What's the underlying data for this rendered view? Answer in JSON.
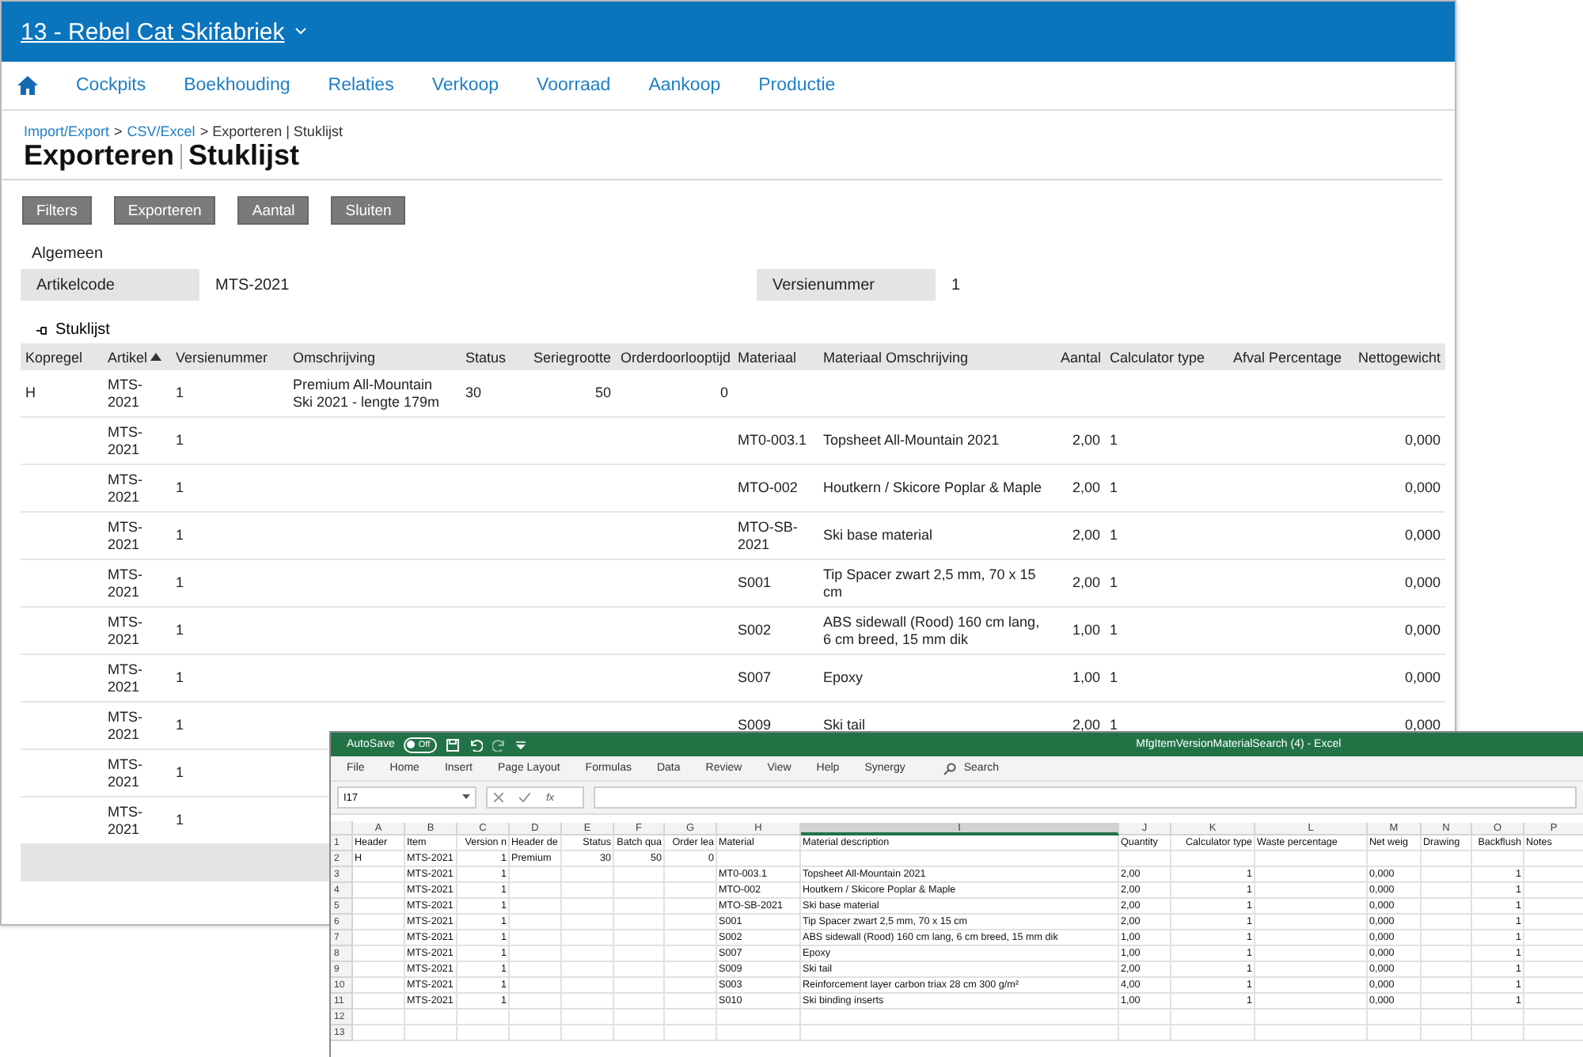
{
  "web": {
    "company": "13 - Rebel Cat Skifabriek",
    "nav": [
      "Cockpits",
      "Boekhouding",
      "Relaties",
      "Verkoop",
      "Voorraad",
      "Aankoop",
      "Productie"
    ],
    "breadcrumb": [
      {
        "label": "Import/Export",
        "link": true
      },
      {
        "label": ">",
        "link": false
      },
      {
        "label": "CSV/Excel",
        "link": true
      },
      {
        "label": "> Exporteren | Stuklijst",
        "link": false
      }
    ],
    "title": [
      "Exporteren",
      "Stuklijst"
    ],
    "buttons": [
      "Filters",
      "Exporteren",
      "Aantal",
      "Sluiten"
    ],
    "general": {
      "title": "Algemeen",
      "fields": [
        {
          "label": "Artikelcode",
          "value": "MTS-2021"
        },
        {
          "label": "Versienummer",
          "value": "1"
        }
      ]
    },
    "bom": {
      "title": "Stuklijst",
      "columns": [
        {
          "label": "Kopregel",
          "numeric": false,
          "sorted": false
        },
        {
          "label": "Artikel",
          "numeric": false,
          "sorted": true
        },
        {
          "label": "Versienummer",
          "numeric": false,
          "sorted": false
        },
        {
          "label": "Omschrijving",
          "numeric": false,
          "sorted": false
        },
        {
          "label": "Status",
          "numeric": false,
          "sorted": false
        },
        {
          "label": "Seriegrootte",
          "numeric": true,
          "sorted": false
        },
        {
          "label": "Orderdoorlooptijd",
          "numeric": true,
          "sorted": false
        },
        {
          "label": "Materiaal",
          "numeric": false,
          "sorted": false
        },
        {
          "label": "Materiaal Omschrijving",
          "numeric": false,
          "sorted": false
        },
        {
          "label": "Aantal",
          "numeric": true,
          "sorted": false
        },
        {
          "label": "Calculator type",
          "numeric": false,
          "sorted": false
        },
        {
          "label": "Afval Percentage",
          "numeric": false,
          "sorted": false
        },
        {
          "label": "Nettogewicht",
          "numeric": true,
          "sorted": false
        }
      ],
      "rows": [
        [
          "H",
          "MTS-2021",
          "1",
          "Premium All-Mountain Ski 2021 - lengte 179m",
          "30",
          "50",
          "0",
          null,
          null,
          null,
          null,
          null,
          null
        ],
        [
          null,
          "MTS-2021",
          "1",
          null,
          null,
          null,
          null,
          "MT0-003.1",
          "Topsheet All-Mountain 2021",
          "2,00",
          "1",
          null,
          "0,000"
        ],
        [
          null,
          "MTS-2021",
          "1",
          null,
          null,
          null,
          null,
          "MTO-002",
          "Houtkern / Skicore Poplar & Maple",
          "2,00",
          "1",
          null,
          "0,000"
        ],
        [
          null,
          "MTS-2021",
          "1",
          null,
          null,
          null,
          null,
          "MTO-SB-2021",
          "Ski base material",
          "2,00",
          "1",
          null,
          "0,000"
        ],
        [
          null,
          "MTS-2021",
          "1",
          null,
          null,
          null,
          null,
          "S001",
          "Tip Spacer zwart 2,5 mm, 70 x 15 cm",
          "2,00",
          "1",
          null,
          "0,000"
        ],
        [
          null,
          "MTS-2021",
          "1",
          null,
          null,
          null,
          null,
          "S002",
          "ABS sidewall (Rood) 160 cm lang, 6 cm breed, 15 mm dik",
          "1,00",
          "1",
          null,
          "0,000"
        ],
        [
          null,
          "MTS-2021",
          "1",
          null,
          null,
          null,
          null,
          "S007",
          "Epoxy",
          "1,00",
          "1",
          null,
          "0,000"
        ],
        [
          null,
          "MTS-2021",
          "1",
          null,
          null,
          null,
          null,
          "S009",
          "Ski tail",
          "2,00",
          "1",
          null,
          "0,000"
        ],
        [
          null,
          "MTS-2021",
          "1",
          null,
          null,
          null,
          null,
          null,
          null,
          null,
          null,
          null,
          null
        ],
        [
          null,
          "MTS-2021",
          "1",
          null,
          null,
          null,
          null,
          null,
          null,
          null,
          null,
          null,
          null
        ]
      ]
    }
  },
  "excel": {
    "autosave": {
      "label": "AutoSave",
      "on": false,
      "state": "Off"
    },
    "title": "MfgItemVersionMaterialSearch (4)  -  Excel",
    "menu": [
      "File",
      "Home",
      "Insert",
      "Page Layout",
      "Formulas",
      "Data",
      "Review",
      "View",
      "Help",
      "Synergy"
    ],
    "search": "Search",
    "name_box": "I17",
    "fx": "fx",
    "columns": [
      {
        "letter": "A",
        "numeric": false,
        "selected": false
      },
      {
        "letter": "B",
        "numeric": false,
        "selected": false
      },
      {
        "letter": "C",
        "numeric": true,
        "selected": false
      },
      {
        "letter": "D",
        "numeric": false,
        "selected": false
      },
      {
        "letter": "E",
        "numeric": true,
        "selected": false
      },
      {
        "letter": "F",
        "numeric": true,
        "selected": false
      },
      {
        "letter": "G",
        "numeric": true,
        "selected": false
      },
      {
        "letter": "H",
        "numeric": false,
        "selected": false
      },
      {
        "letter": "I",
        "numeric": false,
        "selected": true
      },
      {
        "letter": "J",
        "numeric": false,
        "selected": false
      },
      {
        "letter": "K",
        "numeric": true,
        "selected": false
      },
      {
        "letter": "L",
        "numeric": false,
        "selected": false
      },
      {
        "letter": "M",
        "numeric": false,
        "selected": false
      },
      {
        "letter": "N",
        "numeric": false,
        "selected": false
      },
      {
        "letter": "O",
        "numeric": true,
        "selected": false
      },
      {
        "letter": "P",
        "numeric": false,
        "selected": false
      }
    ],
    "rows": [
      {
        "n": "1",
        "cells": [
          "Header",
          "Item",
          "Version n",
          "Header de",
          "Status",
          "Batch qua",
          "Order lea",
          "Material",
          "Material description",
          "Quantity",
          "Calculator type",
          "Waste percentage",
          "Net weig",
          "Drawing",
          "Backflush",
          "Notes"
        ]
      },
      {
        "n": "2",
        "cells": [
          "H",
          "MTS-2021",
          "1",
          "Premium",
          "30",
          "50",
          "0",
          null,
          null,
          null,
          null,
          null,
          null,
          null,
          null,
          null
        ]
      },
      {
        "n": "3",
        "cells": [
          null,
          "MTS-2021",
          "1",
          null,
          null,
          null,
          null,
          "MT0-003.1",
          "Topsheet All-Mountain 2021",
          "2,00",
          "1",
          null,
          "0,000",
          null,
          "1",
          null
        ]
      },
      {
        "n": "4",
        "cells": [
          null,
          "MTS-2021",
          "1",
          null,
          null,
          null,
          null,
          "MTO-002",
          "Houtkern / Skicore Poplar & Maple",
          "2,00",
          "1",
          null,
          "0,000",
          null,
          "1",
          null
        ]
      },
      {
        "n": "5",
        "cells": [
          null,
          "MTS-2021",
          "1",
          null,
          null,
          null,
          null,
          "MTO-SB-2021",
          "Ski base material",
          "2,00",
          "1",
          null,
          "0,000",
          null,
          "1",
          null
        ]
      },
      {
        "n": "6",
        "cells": [
          null,
          "MTS-2021",
          "1",
          null,
          null,
          null,
          null,
          "S001",
          "Tip Spacer zwart 2,5 mm, 70 x 15 cm",
          "2,00",
          "1",
          null,
          "0,000",
          null,
          "1",
          null
        ]
      },
      {
        "n": "7",
        "cells": [
          null,
          "MTS-2021",
          "1",
          null,
          null,
          null,
          null,
          "S002",
          "ABS sidewall (Rood) 160 cm lang, 6 cm breed, 15 mm dik",
          "1,00",
          "1",
          null,
          "0,000",
          null,
          "1",
          null
        ]
      },
      {
        "n": "8",
        "cells": [
          null,
          "MTS-2021",
          "1",
          null,
          null,
          null,
          null,
          "S007",
          "Epoxy",
          "1,00",
          "1",
          null,
          "0,000",
          null,
          "1",
          null
        ]
      },
      {
        "n": "9",
        "cells": [
          null,
          "MTS-2021",
          "1",
          null,
          null,
          null,
          null,
          "S009",
          "Ski tail",
          "2,00",
          "1",
          null,
          "0,000",
          null,
          "1",
          null
        ]
      },
      {
        "n": "10",
        "cells": [
          null,
          "MTS-2021",
          "1",
          null,
          null,
          null,
          null,
          "S003",
          "Reinforcement layer carbon triax 28 cm 300 g/m²",
          "4,00",
          "1",
          null,
          "0,000",
          null,
          "1",
          null
        ]
      },
      {
        "n": "11",
        "cells": [
          null,
          "MTS-2021",
          "1",
          null,
          null,
          null,
          null,
          "S010",
          "Ski binding inserts",
          "1,00",
          "1",
          null,
          "0,000",
          null,
          "1",
          null
        ]
      },
      {
        "n": "12",
        "cells": [
          null,
          null,
          null,
          null,
          null,
          null,
          null,
          null,
          null,
          null,
          null,
          null,
          null,
          null,
          null,
          null
        ]
      },
      {
        "n": "13",
        "cells": [
          null,
          null,
          null,
          null,
          null,
          null,
          null,
          null,
          null,
          null,
          null,
          null,
          null,
          null,
          null,
          null
        ]
      }
    ]
  }
}
